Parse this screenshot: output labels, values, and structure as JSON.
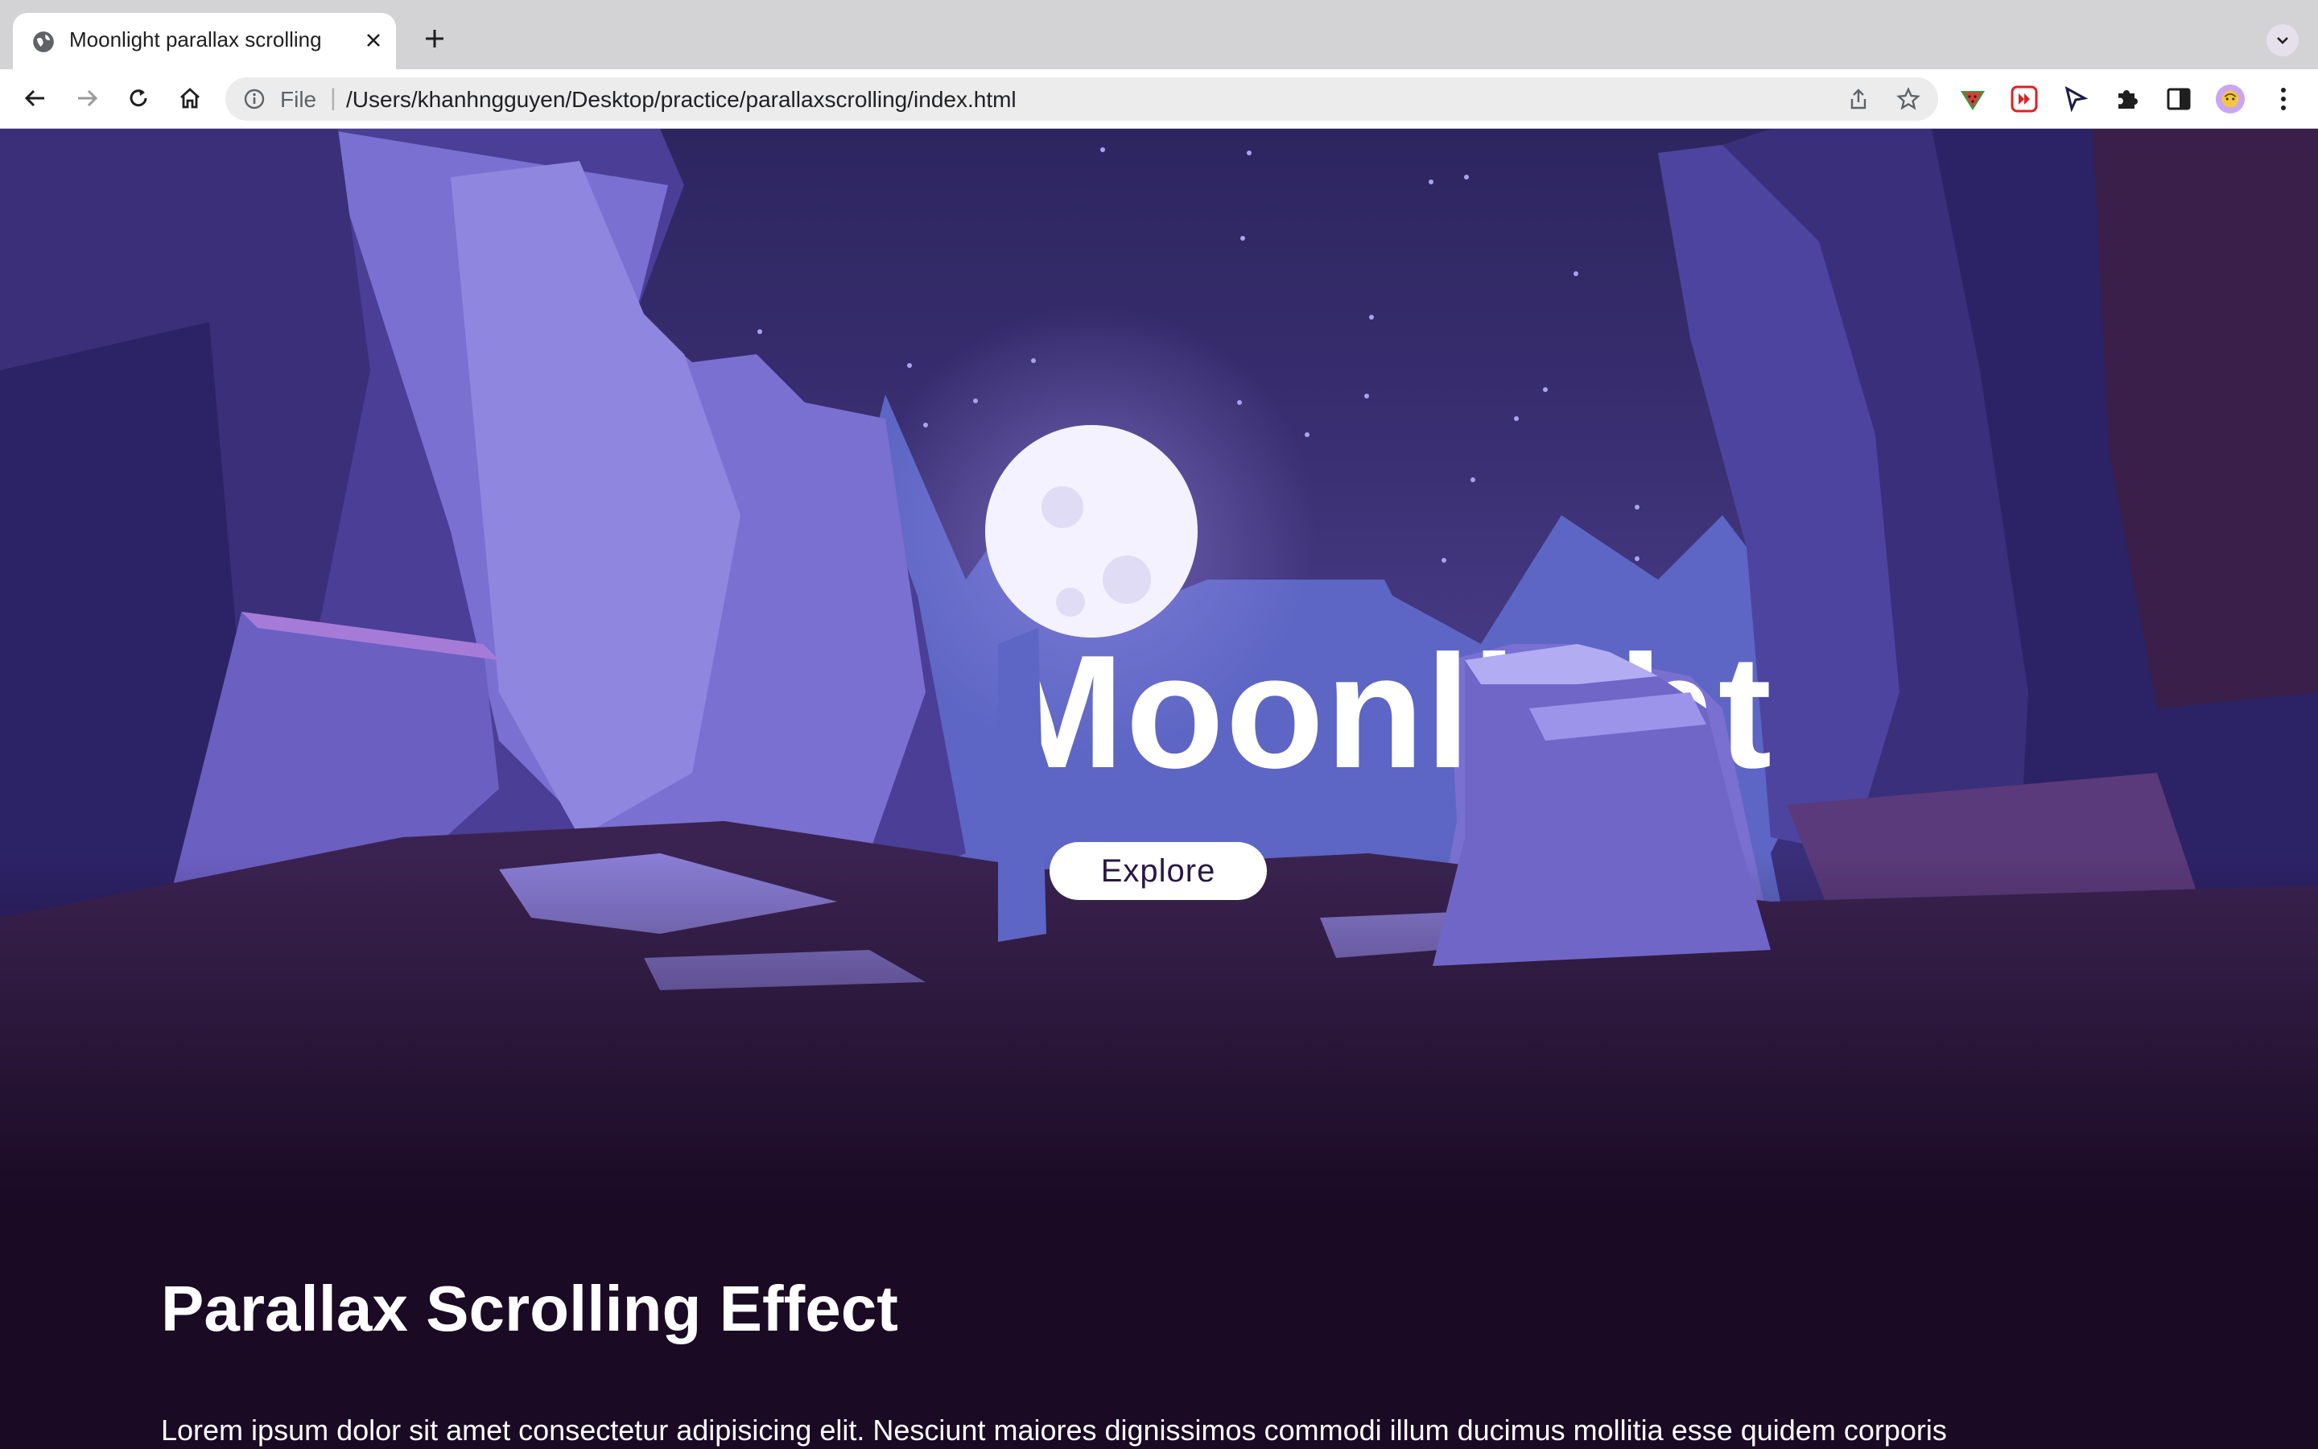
{
  "browser": {
    "tab_title": "Moonlight parallax scrolling",
    "address_scheme": "File",
    "address_url": "/Users/khanhngguyen/Desktop/practice/parallaxscrolling/index.html"
  },
  "hero": {
    "title": "Moonlight",
    "button_label": "Explore"
  },
  "content": {
    "heading": "Parallax Scrolling Effect",
    "paragraph": "Lorem ipsum dolor sit amet consectetur adipisicing elit. Nesciunt maiores dignissimos commodi illum ducimus mollitia esse quidem corporis"
  },
  "colors": {
    "sky": "#2d2560",
    "page_background": "#1a0a24",
    "moon": "#ffffff",
    "rock_light": "#7a6fd0",
    "rock_dark": "#3a2a66"
  }
}
